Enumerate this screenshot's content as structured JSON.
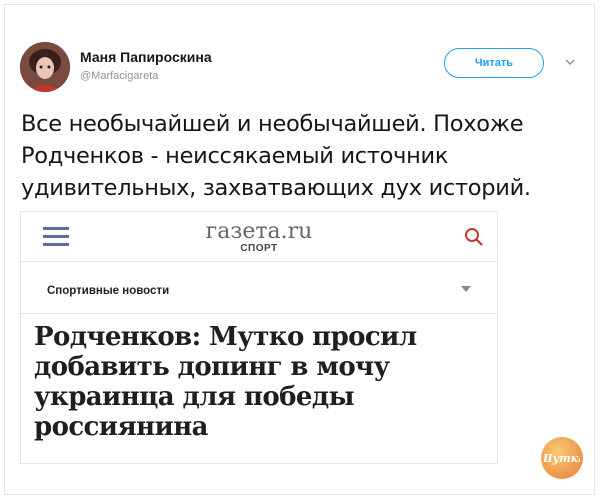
{
  "tweet": {
    "author_name": "Маня Папироскина",
    "author_handle": "@Marfacigareta",
    "follow_label": "Читать",
    "text_lines": [
      "Все необычайшей и необычайшей. Похоже",
      "Родченков - неиссякаемый источник",
      "удивительных, захватвающих дух историй."
    ]
  },
  "card": {
    "logo_main": "газета.ru",
    "logo_sub": "СПОРТ",
    "section_label": "Спортивные новости",
    "headline_lines": [
      "Родченков: Мутко просил",
      "добавить допинг в мочу",
      "украинца для победы",
      "россиянина"
    ]
  },
  "colors": {
    "accent": "#1da1f2",
    "menu_icon": "#5f6c9c",
    "search_icon": "#c0392b",
    "watermark": "#e9822b"
  },
  "watermark_text": "Шутка"
}
